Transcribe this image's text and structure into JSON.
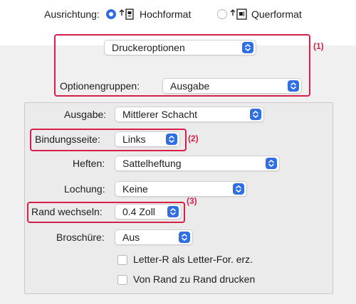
{
  "orientation": {
    "label": "Ausrichtung:",
    "portrait": "Hochformat",
    "landscape": "Querformat",
    "selected": "portrait"
  },
  "section_popup": {
    "value": "Druckeroptionen"
  },
  "option_groups": {
    "label": "Optionengruppen:",
    "value": "Ausgabe"
  },
  "settings": {
    "output": {
      "label": "Ausgabe:",
      "value": "Mittlerer Schacht"
    },
    "binding": {
      "label": "Bindungsseite:",
      "value": "Links"
    },
    "staple": {
      "label": "Heften:",
      "value": "Sattelheftung"
    },
    "punch": {
      "label": "Lochung:",
      "value": "Keine"
    },
    "margin": {
      "label": "Rand wechseln:",
      "value": "0.4 Zoll"
    },
    "booklet": {
      "label": "Broschüre:",
      "value": "Aus"
    }
  },
  "checkboxes": [
    {
      "label": "Letter-R als Letter-For. erz.",
      "checked": false
    },
    {
      "label": "Von Rand zu Rand drucken",
      "checked": false
    }
  ],
  "callouts": [
    "(1)",
    "(2)",
    "(3)"
  ],
  "colors": {
    "accent": "#2f6ee5",
    "highlight": "#d6204b"
  }
}
